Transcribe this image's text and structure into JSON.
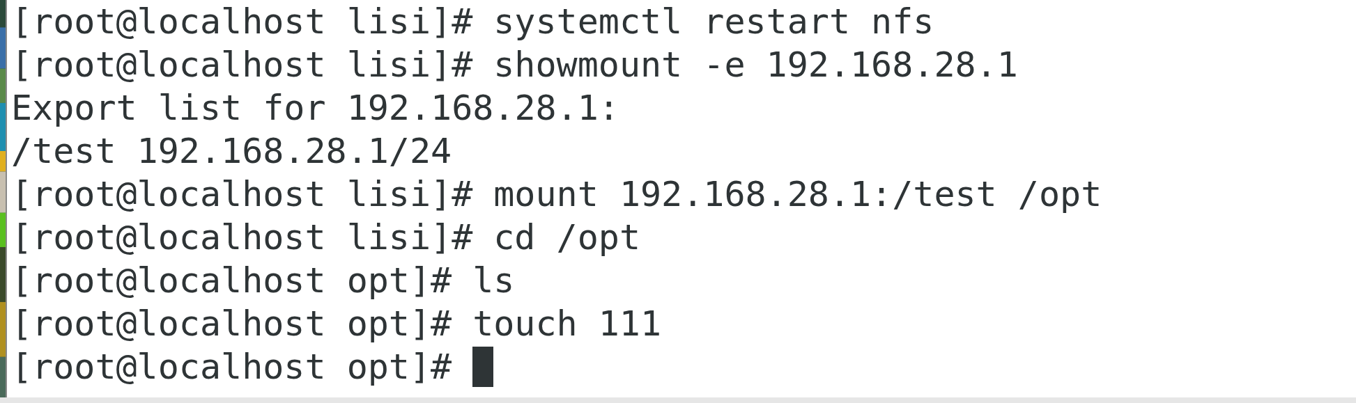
{
  "terminal": {
    "lines": [
      {
        "kind": "prompt",
        "prompt": "[root@localhost lisi]#",
        "command": "systemctl restart nfs"
      },
      {
        "kind": "prompt",
        "prompt": "[root@localhost lisi]#",
        "command": "showmount -e 192.168.28.1"
      },
      {
        "kind": "output",
        "text": "Export list for 192.168.28.1:"
      },
      {
        "kind": "output",
        "text": "/test 192.168.28.1/24"
      },
      {
        "kind": "prompt",
        "prompt": "[root@localhost lisi]#",
        "command": "mount 192.168.28.1:/test /opt"
      },
      {
        "kind": "prompt",
        "prompt": "[root@localhost lisi]#",
        "command": "cd /opt"
      },
      {
        "kind": "prompt",
        "prompt": "[root@localhost opt]#",
        "command": "ls"
      },
      {
        "kind": "prompt",
        "prompt": "[root@localhost opt]#",
        "command": "touch 111"
      },
      {
        "kind": "prompt",
        "prompt": "[root@localhost opt]#",
        "cursor": true
      }
    ]
  }
}
